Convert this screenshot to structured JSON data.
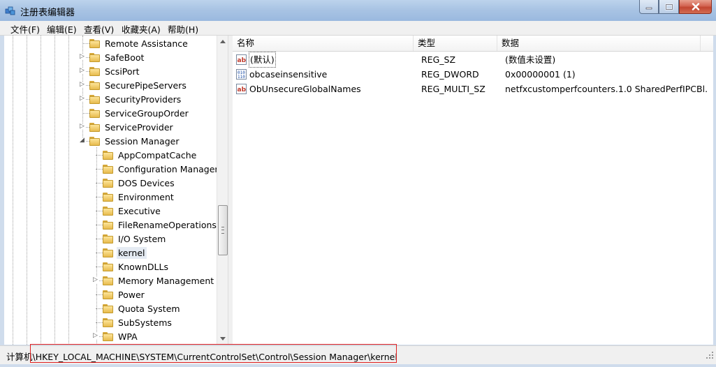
{
  "window": {
    "title": "注册表编辑器"
  },
  "menu": [
    {
      "label": "文件(F)"
    },
    {
      "label": "编辑(E)"
    },
    {
      "label": "查看(V)"
    },
    {
      "label": "收藏夹(A)"
    },
    {
      "label": "帮助(H)"
    }
  ],
  "tree": {
    "items": [
      {
        "label": "Remote Assistance",
        "level": 1,
        "expander": ""
      },
      {
        "label": "SafeBoot",
        "level": 1,
        "expander": "▷"
      },
      {
        "label": "ScsiPort",
        "level": 1,
        "expander": "▷"
      },
      {
        "label": "SecurePipeServers",
        "level": 1,
        "expander": "▷"
      },
      {
        "label": "SecurityProviders",
        "level": 1,
        "expander": "▷"
      },
      {
        "label": "ServiceGroupOrder",
        "level": 1,
        "expander": ""
      },
      {
        "label": "ServiceProvider",
        "level": 1,
        "expander": "▷"
      },
      {
        "label": "Session Manager",
        "level": 1,
        "expander": "◢"
      },
      {
        "label": "AppCompatCache",
        "level": 2,
        "expander": ""
      },
      {
        "label": "Configuration Manager",
        "level": 2,
        "expander": ""
      },
      {
        "label": "DOS Devices",
        "level": 2,
        "expander": ""
      },
      {
        "label": "Environment",
        "level": 2,
        "expander": ""
      },
      {
        "label": "Executive",
        "level": 2,
        "expander": ""
      },
      {
        "label": "FileRenameOperations",
        "level": 2,
        "expander": ""
      },
      {
        "label": "I/O System",
        "level": 2,
        "expander": ""
      },
      {
        "label": "kernel",
        "level": 2,
        "expander": "",
        "selected": true
      },
      {
        "label": "KnownDLLs",
        "level": 2,
        "expander": ""
      },
      {
        "label": "Memory Management",
        "level": 2,
        "expander": "▷"
      },
      {
        "label": "Power",
        "level": 2,
        "expander": ""
      },
      {
        "label": "Quota System",
        "level": 2,
        "expander": ""
      },
      {
        "label": "SubSystems",
        "level": 2,
        "expander": ""
      },
      {
        "label": "WPA",
        "level": 2,
        "expander": "▷"
      }
    ]
  },
  "list": {
    "columns": {
      "name": "名称",
      "type": "类型",
      "data": "数据"
    },
    "rows": [
      {
        "icon": "string-value-icon",
        "name": "(默认)",
        "type": "REG_SZ",
        "data": "(数值未设置)"
      },
      {
        "icon": "binary-value-icon",
        "name": "obcaseinsensitive",
        "type": "REG_DWORD",
        "data": "0x00000001 (1)"
      },
      {
        "icon": "string-value-icon",
        "name": "ObUnsecureGlobalNames",
        "type": "REG_MULTI_SZ",
        "data": "netfxcustomperfcounters.1.0 SharedPerfIPCBl…"
      }
    ]
  },
  "status": {
    "path": "计算机\\HKEY_LOCAL_MACHINE\\SYSTEM\\CurrentControlSet\\Control\\Session Manager\\kernel"
  },
  "colors": {
    "highlight_box": "#e02020",
    "selection": "#e5ebf3"
  }
}
